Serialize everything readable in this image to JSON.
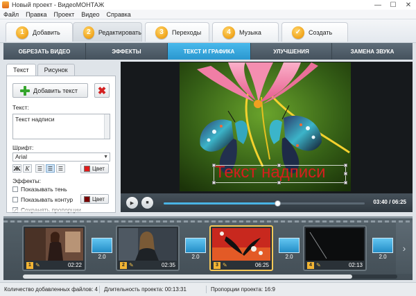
{
  "window": {
    "title": "Новый проект - ВидеоМОНТАЖ",
    "min": "—",
    "max": "☐",
    "close": "✕"
  },
  "menu": [
    "Файл",
    "Правка",
    "Проект",
    "Видео",
    "Справка"
  ],
  "steps": [
    {
      "num": "1",
      "label": "Добавить",
      "active": false
    },
    {
      "num": "2",
      "label": "Редактировать",
      "active": true
    },
    {
      "num": "3",
      "label": "Переходы",
      "active": false
    },
    {
      "num": "4",
      "label": "Музыка",
      "active": false
    },
    {
      "num": "✓",
      "label": "Создать",
      "active": false
    }
  ],
  "subtabs": [
    {
      "label": "ОБРЕЗАТЬ ВИДЕО",
      "active": false
    },
    {
      "label": "ЭФФЕКТЫ",
      "active": false
    },
    {
      "label": "ТЕКСТ И ГРАФИКА",
      "active": true
    },
    {
      "label": "УЛУЧШЕНИЯ",
      "active": false
    },
    {
      "label": "ЗАМЕНА ЗВУКА",
      "active": false
    }
  ],
  "panel": {
    "tabs": [
      "Текст",
      "Рисунок"
    ],
    "add_text": "Добавить текст",
    "text_label": "Текст:",
    "text_value": "Текст надписи",
    "font_label": "Шрифт:",
    "font_value": "Arial",
    "fmt": {
      "bold": "Ж",
      "italic": "К"
    },
    "color_label": "Цвет",
    "effects_label": "Эффекты:",
    "shadow_label": "Показывать тень",
    "outline_label": "Показывать контур",
    "proportions_label": "Сохранять пропорции",
    "text_color": "#e01b1b",
    "outline_color": "#7a0000"
  },
  "preview": {
    "overlay_text": "Текст надписи"
  },
  "player": {
    "time": "03:40 / 06:25",
    "progress": 0.57
  },
  "clips": [
    {
      "idx": "1",
      "dur": "02:22",
      "active": false
    },
    {
      "idx": "2",
      "dur": "02:35",
      "active": false
    },
    {
      "idx": "3",
      "dur": "06:25",
      "active": true
    },
    {
      "idx": "4",
      "dur": "02:13",
      "active": false
    }
  ],
  "transitions": [
    "2.0",
    "2.0",
    "2.0",
    "2.0"
  ],
  "status": {
    "files": "Количество добавленных файлов: 4",
    "duration": "Длительность проекта: 00:13:31",
    "proportions": "Пропорции проекта: 16:9"
  }
}
